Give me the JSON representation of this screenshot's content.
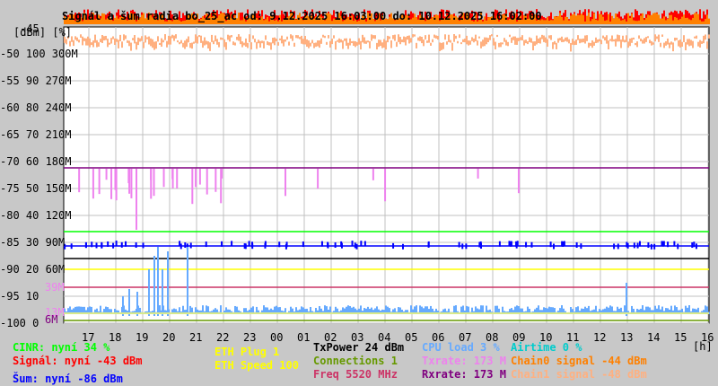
{
  "chart_data": {
    "type": "line",
    "title": "Signál a šum radia bo_25_ac od: 9.12.2025 16:03:00 do: 10.12.2025 16:02:00",
    "y_unit_label": "[dBm] [%]",
    "xlabel": "[h]",
    "x_ticks": [
      "17",
      "18",
      "19",
      "20",
      "21",
      "22",
      "23",
      "00",
      "01",
      "02",
      "03",
      "04",
      "05",
      "06",
      "07",
      "08",
      "09",
      "10",
      "11",
      "12",
      "13",
      "14",
      "15",
      "16"
    ],
    "y_ticks_dbm": [
      "-45",
      "-50",
      "-55",
      "-60",
      "-65",
      "-70",
      "-75",
      "-80",
      "-85",
      "-90",
      "-95",
      "-100"
    ],
    "y_ticks_pct": [
      "",
      "100",
      "90",
      "80",
      "70",
      "60",
      "50",
      "40",
      "30",
      "20",
      "10",
      "0"
    ],
    "y_ticks_rate": [
      "",
      "300M",
      "270M",
      "240M",
      "210M",
      "180M",
      "150M",
      "120M",
      "90M",
      "60M",
      "",
      ""
    ],
    "rate_markers": [
      {
        "label": "39M",
        "color": "#ee82ee"
      },
      {
        "label": "13M",
        "color": "#ee82ee"
      },
      {
        "label": "6M",
        "color": "#800080"
      }
    ],
    "ylim_dbm": [
      -100,
      -45
    ],
    "grid": true,
    "series": [
      {
        "name": "Signál",
        "unit": "dBm",
        "current": -43,
        "color": "#ff0000"
      },
      {
        "name": "Šum",
        "unit": "dBm",
        "current": -86,
        "color": "#0000ff"
      },
      {
        "name": "CINR",
        "unit": "%",
        "current": 34,
        "color": "#00ff00"
      },
      {
        "name": "Chain0 signal",
        "unit": "dBm",
        "current": -44,
        "color": "#ff8000"
      },
      {
        "name": "Chain1 signal",
        "unit": "dBm",
        "current": -48,
        "color": "#ffb080"
      },
      {
        "name": "CPU load",
        "unit": "%",
        "current": 3,
        "color": "#66aaff"
      },
      {
        "name": "Airtime",
        "unit": "%",
        "current": 0,
        "color": "#00cccc"
      },
      {
        "name": "Txrate",
        "unit": "M",
        "current": 173,
        "color": "#ee82ee"
      },
      {
        "name": "Rxrate",
        "unit": "M",
        "current": 173,
        "color": "#800080"
      },
      {
        "name": "ETH Speed",
        "current": 100,
        "color": "#ffff00"
      },
      {
        "name": "TxPower",
        "unit": "dBm",
        "current": 24,
        "color": "#000000"
      },
      {
        "name": "Connections",
        "current": 1,
        "color": "#669900"
      },
      {
        "name": "Freq",
        "unit": "MHz",
        "current": 5520,
        "color": "#cc3366"
      }
    ]
  },
  "legend": {
    "cinr": "CINR: nyní 34 %",
    "signal": "Signál: nyní -43 dBm",
    "noise": "Šum: nyní -86 dBm",
    "eth_plug": "ETH Plug 1",
    "eth_speed": "ETH Speed 100",
    "txpower": "TxPower 24 dBm",
    "connections": "Connections 1",
    "freq": "Freq 5520 MHz",
    "cpu": "CPU load 3 %",
    "txrate": "Txrate: 173 M",
    "rxrate": "Rxrate: 173 M",
    "airtime": "Airtime 0 %",
    "chain0": "Chain0 signal -44 dBm",
    "chain1": "Chain1 signal -48 dBm"
  }
}
